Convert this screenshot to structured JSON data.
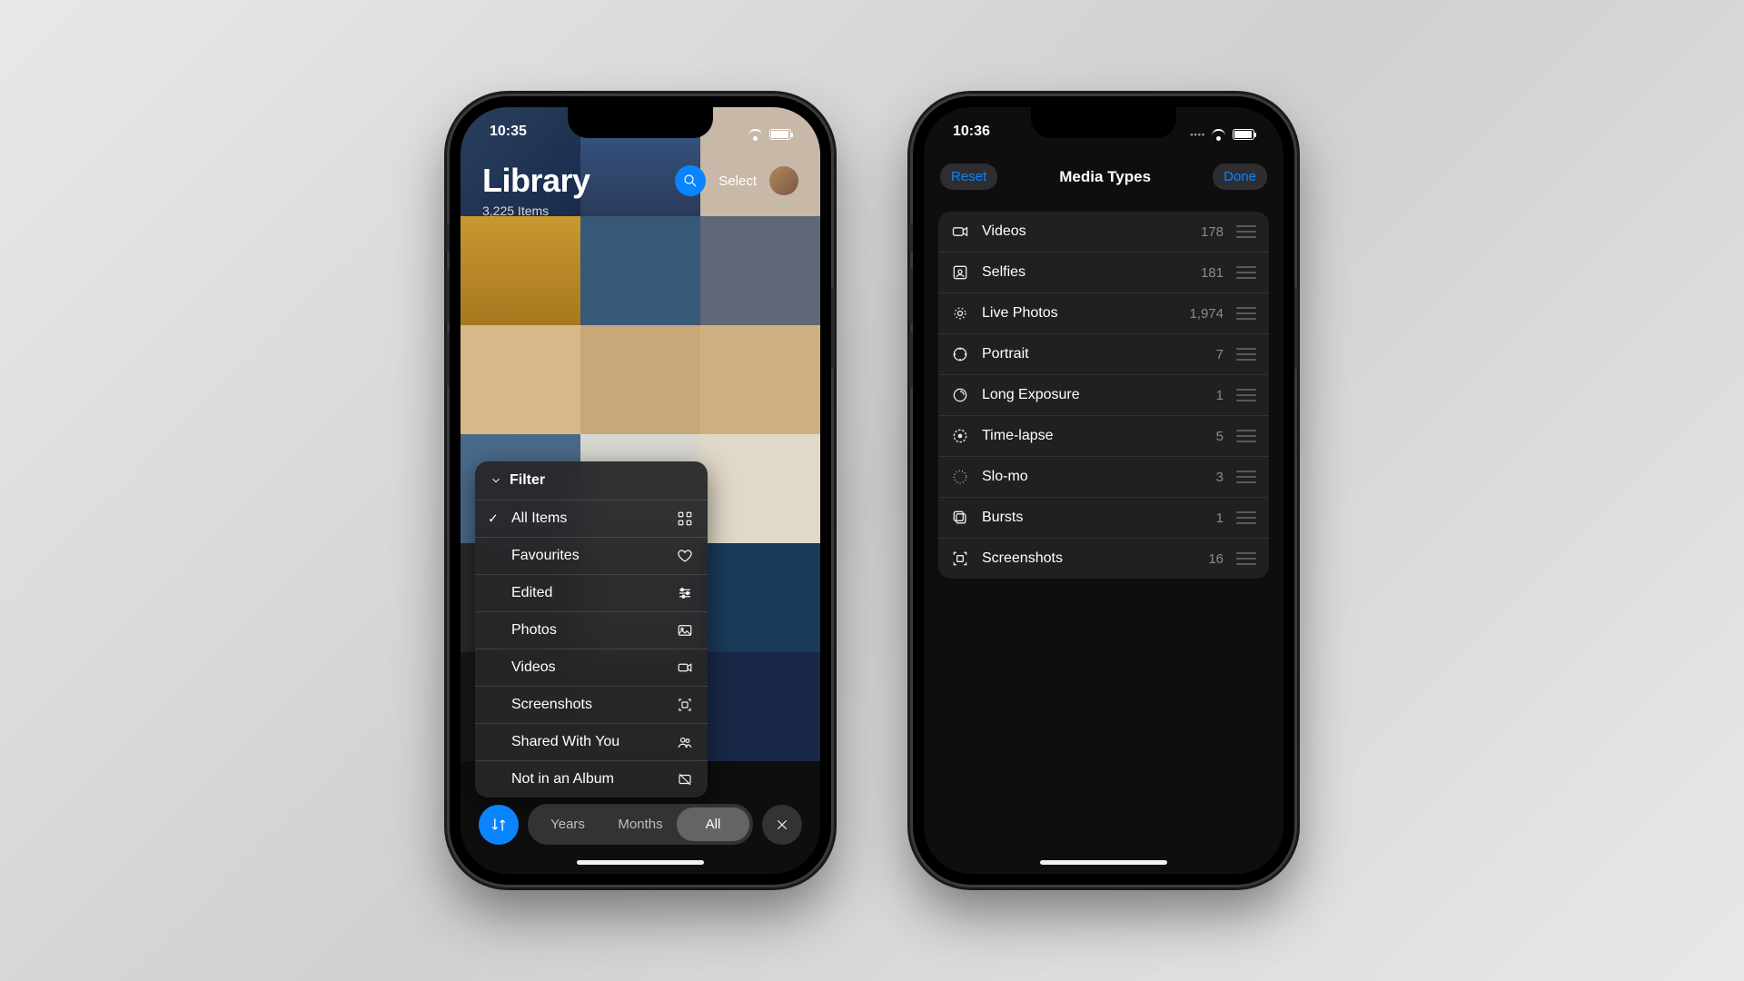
{
  "left": {
    "status_time": "10:35",
    "title": "Library",
    "item_count": "3,225 Items",
    "select_label": "Select",
    "filter": {
      "header": "Filter",
      "items": [
        {
          "label": "All Items",
          "checked": true,
          "icon": "grid"
        },
        {
          "label": "Favourites",
          "checked": false,
          "icon": "heart"
        },
        {
          "label": "Edited",
          "checked": false,
          "icon": "sliders"
        },
        {
          "label": "Photos",
          "checked": false,
          "icon": "image"
        },
        {
          "label": "Videos",
          "checked": false,
          "icon": "video"
        },
        {
          "label": "Screenshots",
          "checked": false,
          "icon": "screenshot"
        },
        {
          "label": "Shared With You",
          "checked": false,
          "icon": "people"
        },
        {
          "label": "Not in an Album",
          "checked": false,
          "icon": "noalbum"
        }
      ]
    },
    "segment": {
      "items": [
        "Years",
        "Months",
        "All"
      ],
      "active": "All"
    }
  },
  "right": {
    "status_time": "10:36",
    "reset_label": "Reset",
    "done_label": "Done",
    "title": "Media Types",
    "rows": [
      {
        "icon": "video",
        "label": "Videos",
        "count": "178"
      },
      {
        "icon": "selfie",
        "label": "Selfies",
        "count": "181"
      },
      {
        "icon": "live",
        "label": "Live Photos",
        "count": "1,974"
      },
      {
        "icon": "portrait",
        "label": "Portrait",
        "count": "7"
      },
      {
        "icon": "longexp",
        "label": "Long Exposure",
        "count": "1"
      },
      {
        "icon": "timelapse",
        "label": "Time-lapse",
        "count": "5"
      },
      {
        "icon": "slomo",
        "label": "Slo-mo",
        "count": "3"
      },
      {
        "icon": "bursts",
        "label": "Bursts",
        "count": "1"
      },
      {
        "icon": "screenshot",
        "label": "Screenshots",
        "count": "16"
      }
    ]
  }
}
